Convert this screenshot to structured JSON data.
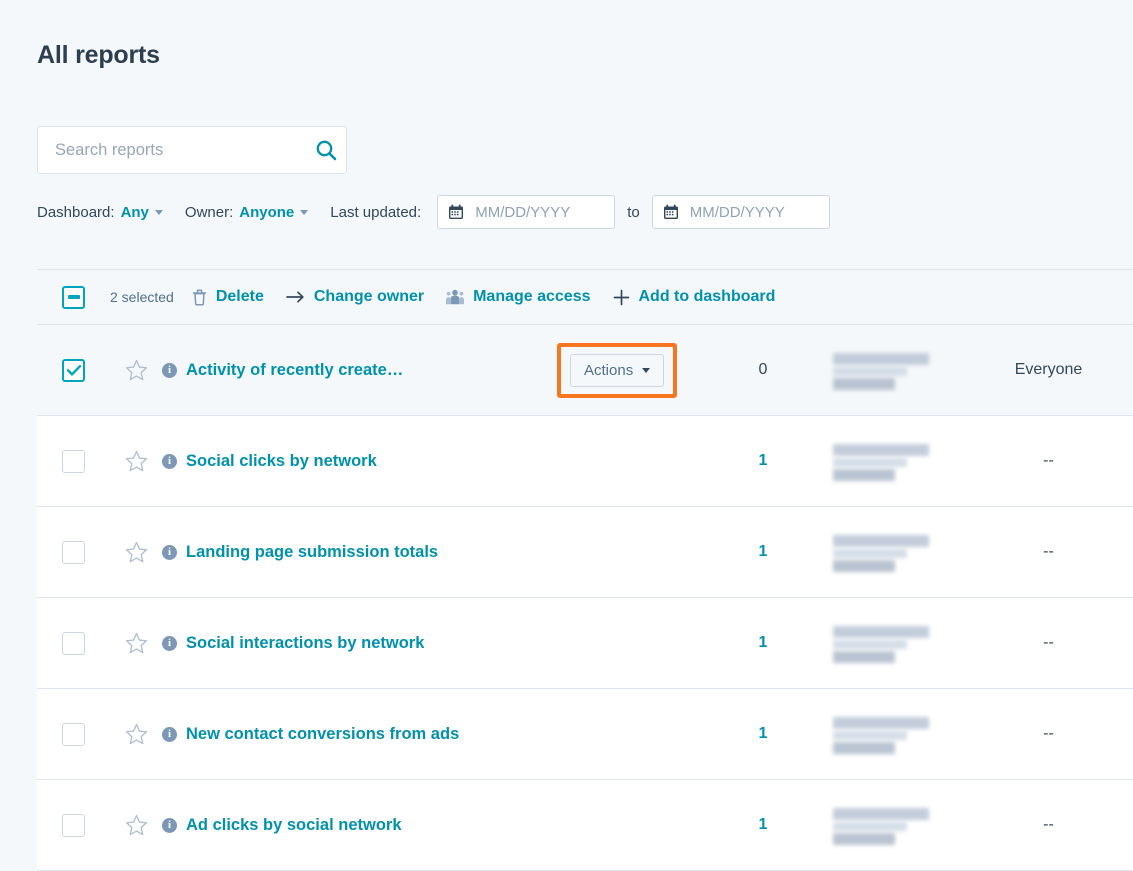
{
  "page": {
    "title": "All reports"
  },
  "search": {
    "placeholder": "Search reports",
    "value": "",
    "icon": "search-icon"
  },
  "filters": {
    "dashboard_label": "Dashboard:",
    "dashboard_value": "Any",
    "owner_label": "Owner:",
    "owner_value": "Anyone",
    "last_updated_label": "Last updated:",
    "date_from_placeholder": "MM/DD/YYYY",
    "date_from_value": "",
    "date_to_placeholder": "MM/DD/YYYY",
    "date_to_value": "",
    "to_label": "to",
    "calendar_icon": "calendar-icon"
  },
  "toolbar": {
    "select_all_state": "indeterminate",
    "selected_count": "2 selected",
    "actions": [
      {
        "label": "Delete",
        "icon": "trash-icon"
      },
      {
        "label": "Change owner",
        "icon": "arrow-right-icon"
      },
      {
        "label": "Manage access",
        "icon": "people-icon"
      },
      {
        "label": "Add to dashboard",
        "icon": "plus-icon"
      }
    ]
  },
  "table": {
    "rows": [
      {
        "checked": true,
        "selected": true,
        "starred": false,
        "name": "Activity of recently create…",
        "has_actions_button": true,
        "actions_label": "Actions",
        "count": "0",
        "count_is_link": false,
        "owner_redacted": true,
        "access": "Everyone"
      },
      {
        "checked": false,
        "selected": false,
        "starred": false,
        "name": "Social clicks by network",
        "has_actions_button": false,
        "actions_label": "",
        "count": "1",
        "count_is_link": true,
        "owner_redacted": true,
        "access": "--"
      },
      {
        "checked": false,
        "selected": false,
        "starred": false,
        "name": "Landing page submission totals",
        "has_actions_button": false,
        "actions_label": "",
        "count": "1",
        "count_is_link": true,
        "owner_redacted": true,
        "access": "--"
      },
      {
        "checked": false,
        "selected": false,
        "starred": false,
        "name": "Social interactions by network",
        "has_actions_button": false,
        "actions_label": "",
        "count": "1",
        "count_is_link": true,
        "owner_redacted": true,
        "access": "--"
      },
      {
        "checked": false,
        "selected": false,
        "starred": false,
        "name": "New contact conversions from ads",
        "has_actions_button": false,
        "actions_label": "",
        "count": "1",
        "count_is_link": true,
        "owner_redacted": true,
        "access": "--"
      },
      {
        "checked": false,
        "selected": false,
        "starred": false,
        "name": "Ad clicks by social network",
        "has_actions_button": false,
        "actions_label": "",
        "count": "1",
        "count_is_link": true,
        "owner_redacted": true,
        "access": "--"
      }
    ]
  },
  "colors": {
    "accent_teal": "#0091ae",
    "checkbox_teal": "#00a4bd",
    "highlight_orange": "#f8761f",
    "page_background": "#f5f8fa",
    "text_primary": "#33475b"
  }
}
